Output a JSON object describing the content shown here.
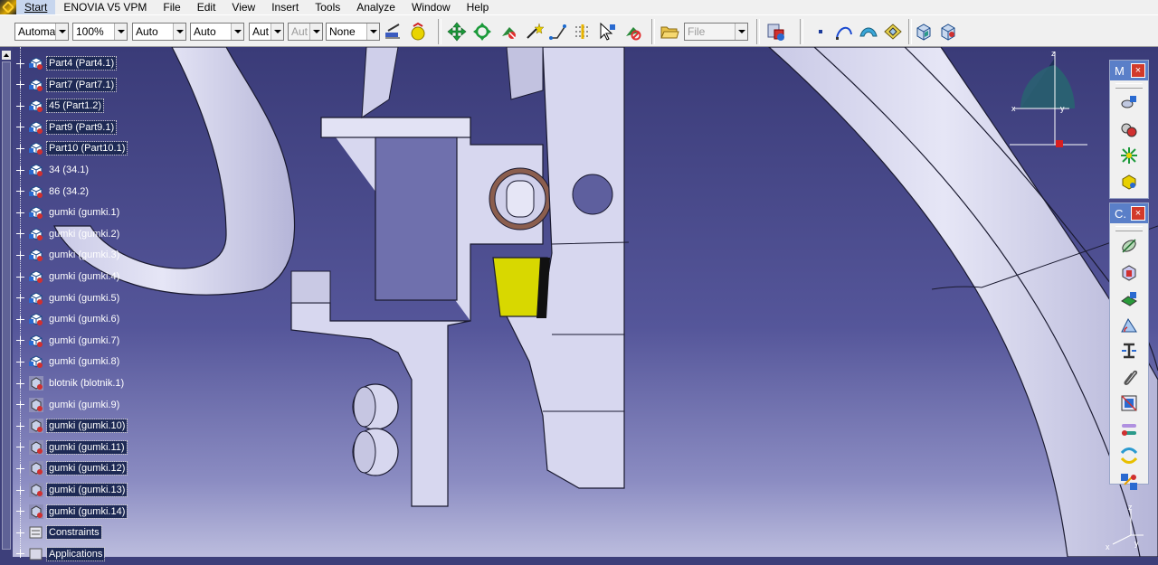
{
  "menu": {
    "items": [
      {
        "label": "Start",
        "name": "menu-start"
      },
      {
        "label": "ENOVIA V5 VPM",
        "name": "menu-enovia"
      },
      {
        "label": "File",
        "name": "menu-file"
      },
      {
        "label": "Edit",
        "name": "menu-edit"
      },
      {
        "label": "View",
        "name": "menu-view"
      },
      {
        "label": "Insert",
        "name": "menu-insert"
      },
      {
        "label": "Tools",
        "name": "menu-tools"
      },
      {
        "label": "Analyze",
        "name": "menu-analyze"
      },
      {
        "label": "Window",
        "name": "menu-window"
      },
      {
        "label": "Help",
        "name": "menu-help"
      }
    ]
  },
  "toolbar": {
    "combos": [
      {
        "value": "Automa",
        "name": "color-combo"
      },
      {
        "value": "100%",
        "name": "transparency-combo"
      },
      {
        "value": "Auto",
        "name": "line-thickness-combo"
      },
      {
        "value": "Auto",
        "name": "line-type-combo"
      },
      {
        "value": "Aut",
        "name": "point-type-combo"
      },
      {
        "value": "Aut",
        "name": "rendering-style-combo",
        "disabled": true
      },
      {
        "value": "None",
        "name": "layer-combo"
      },
      {
        "value": "File",
        "name": "file-combo",
        "disabled": true
      }
    ]
  },
  "tree": {
    "nodes": [
      {
        "label": "Part4 (Part4.1)",
        "icon": "part-icon",
        "highlight": true
      },
      {
        "label": "Part7 (Part7.1)",
        "icon": "part-icon",
        "highlight": true
      },
      {
        "label": "45 (Part1.2)",
        "icon": "part-icon",
        "highlight": true
      },
      {
        "label": "Part9 (Part9.1)",
        "icon": "part-icon",
        "highlight": true
      },
      {
        "label": "Part10 (Part10.1)",
        "icon": "part-icon",
        "highlight": true
      },
      {
        "label": "34 (34.1)",
        "icon": "part-icon",
        "highlight": false
      },
      {
        "label": "86 (34.2)",
        "icon": "part-icon",
        "highlight": false
      },
      {
        "label": "gumki (gumki.1)",
        "icon": "part-icon",
        "highlight": false
      },
      {
        "label": "gumki (gumki.2)",
        "icon": "part-icon",
        "highlight": false
      },
      {
        "label": "gumki (gumki.3)",
        "icon": "part-icon",
        "highlight": false
      },
      {
        "label": "gumki (gumki.4)",
        "icon": "part-icon",
        "highlight": false
      },
      {
        "label": "gumki (gumki.5)",
        "icon": "part-icon",
        "highlight": false
      },
      {
        "label": "gumki (gumki.6)",
        "icon": "part-icon",
        "highlight": false
      },
      {
        "label": "gumki (gumki.7)",
        "icon": "part-icon",
        "highlight": false
      },
      {
        "label": "gumki (gumki.8)",
        "icon": "part-icon",
        "highlight": false
      },
      {
        "label": "blotnik (blotnik.1)",
        "icon": "part-gray-icon",
        "highlight": false
      },
      {
        "label": "gumki (gumki.9)",
        "icon": "part-gray-icon",
        "highlight": false
      },
      {
        "label": "gumki (gumki.10)",
        "icon": "part-gray-icon",
        "highlight": true
      },
      {
        "label": "gumki (gumki.11)",
        "icon": "part-gray-icon",
        "highlight": true
      },
      {
        "label": "gumki (gumki.12)",
        "icon": "part-gray-icon",
        "highlight": true
      },
      {
        "label": "gumki (gumki.13)",
        "icon": "part-gray-icon",
        "highlight": true
      },
      {
        "label": "gumki (gumki.14)",
        "icon": "part-gray-icon",
        "highlight": true
      },
      {
        "label": "Constraints",
        "icon": "constraints-icon",
        "highlight": true
      },
      {
        "label": "Applications",
        "icon": "applications-icon",
        "highlight": true
      }
    ]
  },
  "floating": {
    "manipulation_title": "M",
    "constraints_title": "C."
  },
  "compass": {
    "labels": {
      "x": "x",
      "y": "y",
      "z": "z"
    }
  },
  "axis": {
    "labels": {
      "x": "x",
      "y": "y",
      "z": "z"
    }
  },
  "colors": {
    "accent": "#5a7fc8",
    "highlight_part": "#d8d800",
    "background": "#3d3f7a",
    "part": "#d7d7ef"
  }
}
